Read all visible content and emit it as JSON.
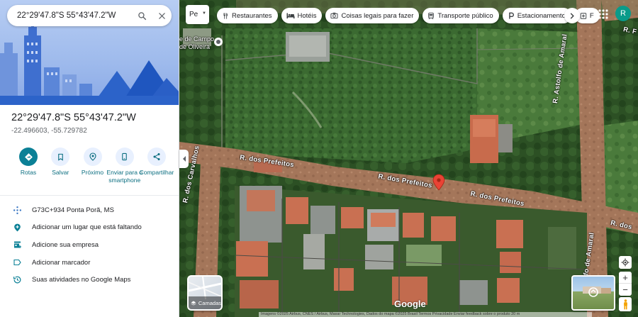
{
  "search": {
    "query": "22°29'47.8\"S 55°43'47.2\"W"
  },
  "place": {
    "title": "22°29'47.8\"S 55°43'47.2\"W",
    "decimal": "-22.496603, -55.729782"
  },
  "actions": [
    {
      "label": "Rotas",
      "icon": "directions-icon"
    },
    {
      "label": "Salvar",
      "icon": "bookmark-icon"
    },
    {
      "label": "Próximo",
      "icon": "nearby-icon"
    },
    {
      "label": "Enviar para o smartphone",
      "icon": "phone-icon"
    },
    {
      "label": "Compartilhar",
      "icon": "share-icon"
    }
  ],
  "info": [
    {
      "text": "G73C+934 Ponta Porã, MS",
      "icon": "plus-code-icon"
    },
    {
      "text": "Adicionar um lugar que está faltando",
      "icon": "add-place-icon"
    },
    {
      "text": "Adicione sua empresa",
      "icon": "business-icon"
    },
    {
      "text": "Adicionar marcador",
      "icon": "label-icon"
    },
    {
      "text": "Suas atividades no Google Maps",
      "icon": "history-icon"
    }
  ],
  "map": {
    "lang_selector": "Pe",
    "chips": [
      {
        "label": "Restaurantes",
        "icon": "restaurant-icon"
      },
      {
        "label": "Hotéis",
        "icon": "hotel-icon"
      },
      {
        "label": "Coisas legais para fazer",
        "icon": "camera-icon"
      },
      {
        "label": "Transporte público",
        "icon": "transit-icon"
      },
      {
        "label": "Estacionamento",
        "icon": "parking-icon"
      },
      {
        "label": "F",
        "icon": "pharmacy-icon"
      }
    ],
    "roads": {
      "prefeitos_west": "R. dos Prefeitos",
      "prefeitos_mid": "R. dos Prefeitos",
      "prefeitos_east": "R. dos Prefeitos",
      "carvalhos": "R. dos Carvalhos",
      "astolfo": "R. Astolfo de Amaral",
      "amaral_bottom": "R. Astolfo de Amaral",
      "corner_top": "R. F",
      "corner_right": "R. dos"
    },
    "town_label": "e de Campo\nde Oliveira",
    "layers_label": "Camadas",
    "google_logo": "Google",
    "attribution": "Imagens ©2025 Airbus, CNES / Airbus, Maxar Technologies, Dados do mapa ©2025   Brasil   Termos   Privacidade   Enviar feedback sobre o produto   20 m",
    "avatar_letter": "R",
    "colors": {
      "accent": "#0b8096",
      "pin": "#ea4335"
    }
  }
}
